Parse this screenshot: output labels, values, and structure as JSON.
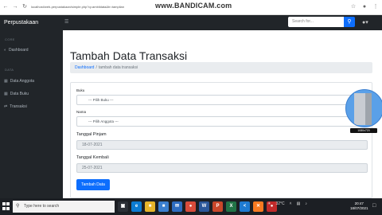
{
  "browser": {
    "url": "localhost/web-perpustakaan/simple.php?q=ambildata&tr=tampilan",
    "watermark": "www.BANDICAM.com"
  },
  "navbar": {
    "brand": "Perpustakaan",
    "search_placeholder": "Search for...",
    "search_icon": "search-icon",
    "user_icon": "user-icon"
  },
  "sidebar": {
    "sections": [
      {
        "heading": "Core",
        "items": [
          {
            "label": "Dashboard",
            "icon": "gauge-icon"
          }
        ]
      },
      {
        "heading": "Data",
        "items": [
          {
            "label": "Data Anggota",
            "icon": "table-icon"
          },
          {
            "label": "Data Buku",
            "icon": "book-icon"
          },
          {
            "label": "Transaksi",
            "icon": "exchange-icon"
          }
        ]
      }
    ]
  },
  "main": {
    "title": "Tambah Data Transaksi",
    "breadcrumb": {
      "link": "Dashboard",
      "separator": "/",
      "current": "tambah data transaksi"
    },
    "form": {
      "buku_label": "Buku",
      "buku_value": "--- Pilih Buku ---",
      "nama_label": "Nama",
      "nama_value": "--- Pilih Anggota ---",
      "pinjam_label": "Tanggal Pinjam",
      "pinjam_value": "18-07-2021",
      "kembali_label": "Tanggal Kembali",
      "kembali_value": "25-07-2021",
      "submit_label": "Tambah Data"
    }
  },
  "webcam": {
    "label": "1080x720"
  },
  "taskbar": {
    "search_placeholder": "Type here to search",
    "apps": [
      {
        "name": "task-view",
        "glyph": "▣",
        "color": "#2b2f36"
      },
      {
        "name": "edge",
        "glyph": "e",
        "color": "#0b7bd3"
      },
      {
        "name": "file-explorer",
        "glyph": "■",
        "color": "#e6b42a"
      },
      {
        "name": "store",
        "glyph": "■",
        "color": "#3b7fd0"
      },
      {
        "name": "mail",
        "glyph": "✉",
        "color": "#2d6cc0"
      },
      {
        "name": "chrome",
        "glyph": "●",
        "color": "#d94c3b"
      },
      {
        "name": "word",
        "glyph": "W",
        "color": "#2b579a"
      },
      {
        "name": "powerpoint",
        "glyph": "P",
        "color": "#c9472a"
      },
      {
        "name": "excel",
        "glyph": "X",
        "color": "#217346"
      },
      {
        "name": "vscode",
        "glyph": "<",
        "color": "#1e7ad1"
      },
      {
        "name": "xampp",
        "glyph": "✕",
        "color": "#f77a21"
      },
      {
        "name": "bandicam",
        "glyph": "●",
        "color": "#c12a2a"
      }
    ],
    "weather": "32°C",
    "time": "20:47",
    "date": "18/07/2021"
  }
}
